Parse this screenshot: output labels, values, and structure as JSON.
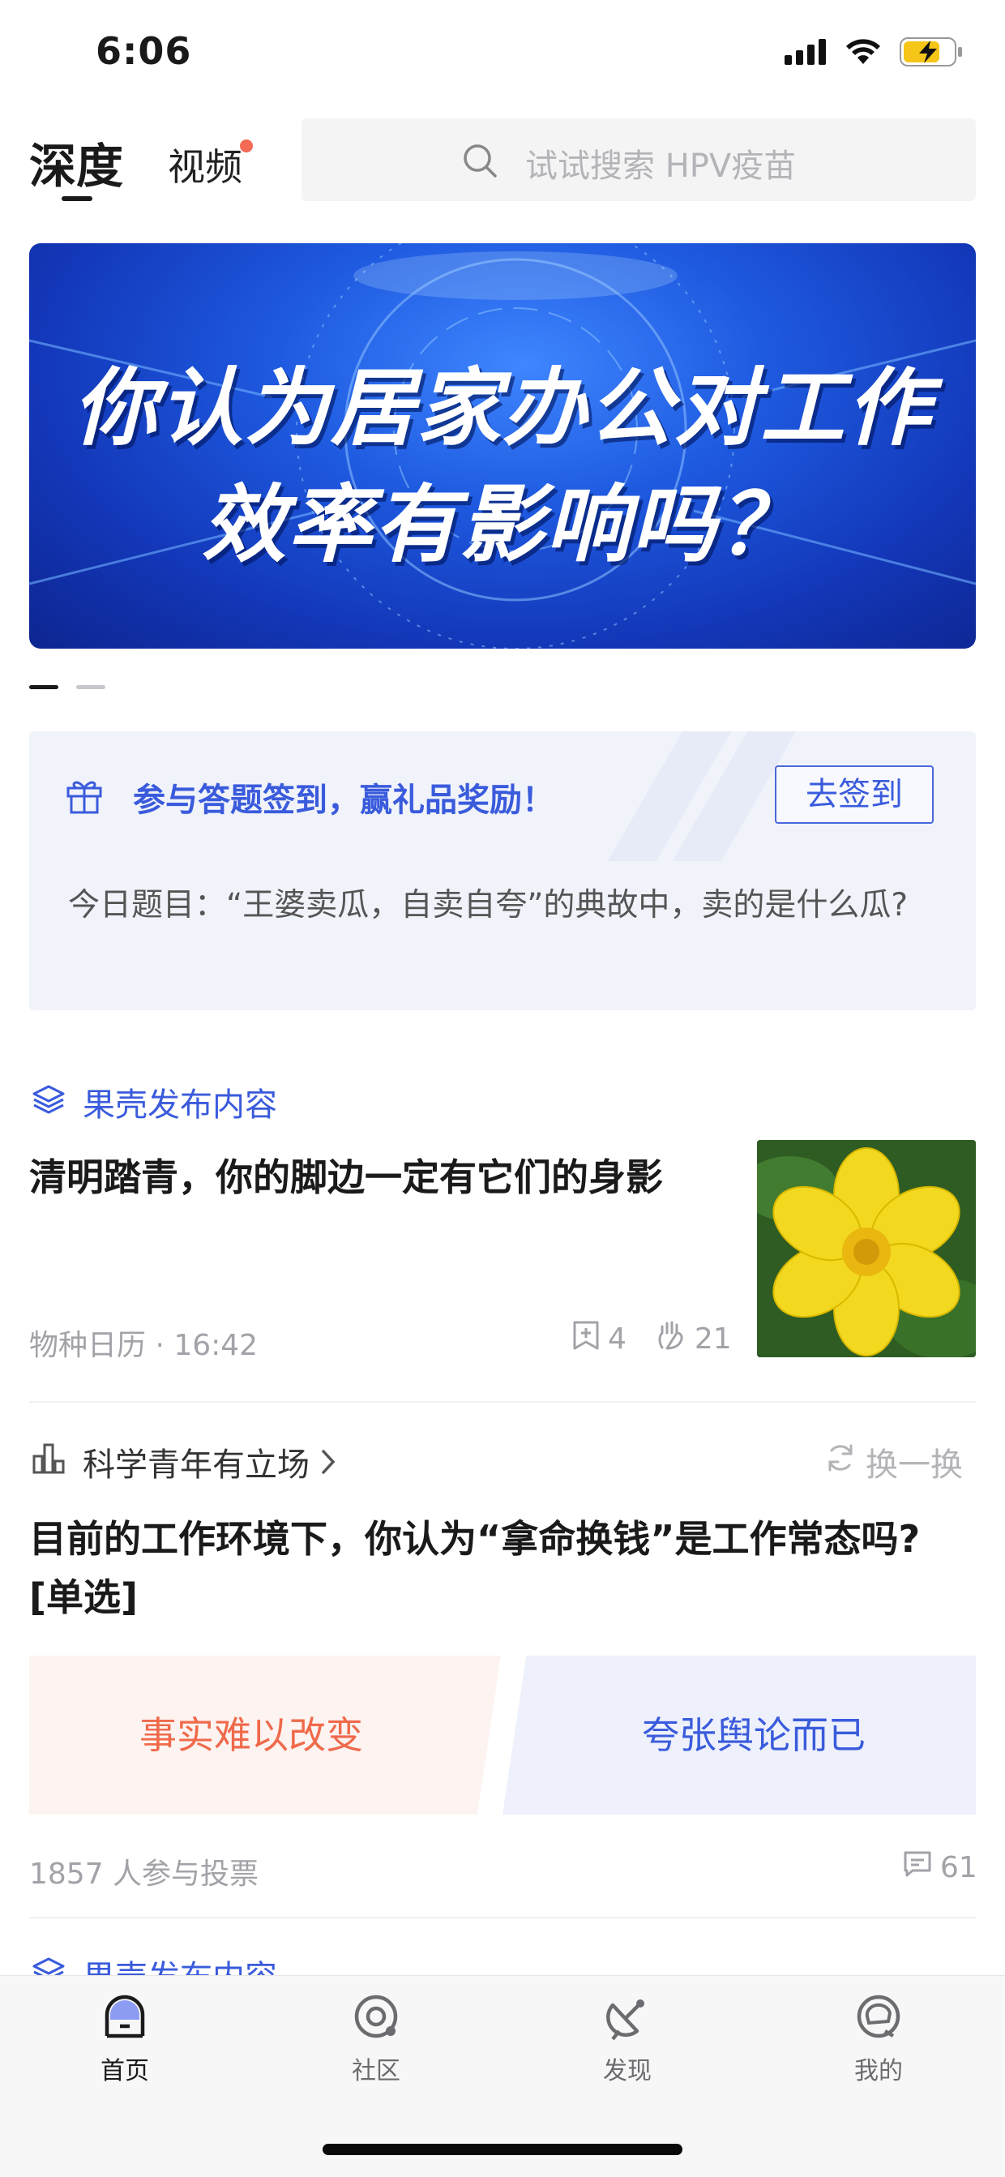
{
  "status_bar": {
    "time": "6:06"
  },
  "header": {
    "tab_deep": "深度",
    "tab_video": "视频",
    "search_placeholder": "试试搜索 HPV疫苗"
  },
  "banner": {
    "line1": "你认为居家办公对工作",
    "line2": "效率有影响吗？"
  },
  "signin": {
    "title": "参与答题签到，赢礼品奖励！",
    "button": "去签到",
    "question": "今日题目：“王婆卖瓜，自卖自夸”的典故中，卖的是什么瓜?"
  },
  "article": {
    "source": "果壳发布内容",
    "title": "清明踏青，你的脚边一定有它们的身影",
    "meta": "物种日历 · 16:42",
    "bookmarks": "4",
    "likes": "21"
  },
  "poll": {
    "source": "科学青年有立场",
    "refresh": "换一换",
    "question": "目前的工作环境下，你认为“拿命换钱”是工作常态吗? [单选]",
    "option_a": "事实难以改变",
    "option_b": "夸张舆论而已",
    "participants": "1857 人参与投票",
    "comments": "61"
  },
  "next_item": {
    "source": "果壳发布内容"
  },
  "tabbar": {
    "home": "首页",
    "community": "社区",
    "discover": "发现",
    "mine": "我的"
  },
  "colors": {
    "accent_blue": "#3a5bdc",
    "accent_orange": "#ef6a4b",
    "red_dot": "#f36a55"
  }
}
